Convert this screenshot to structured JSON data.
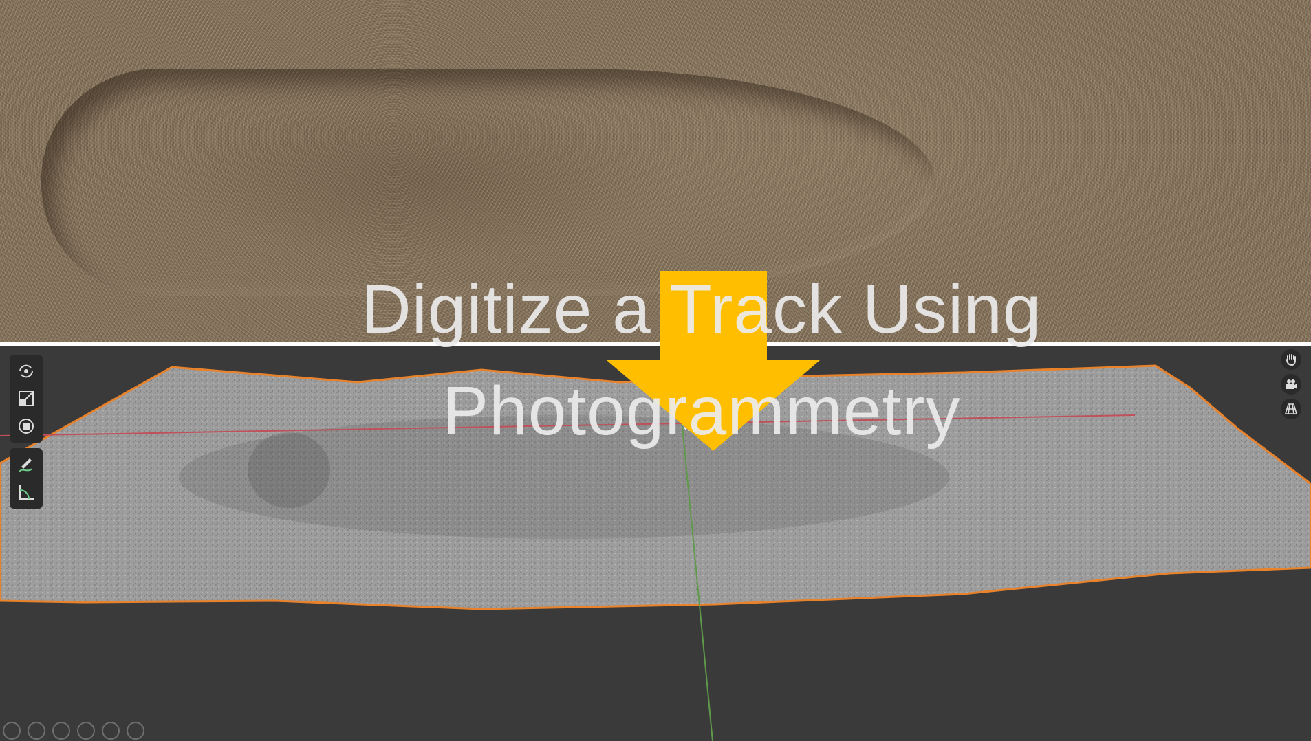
{
  "title": {
    "line1": "Digitize a Track Using",
    "line2": "Photogrammetry"
  },
  "colors": {
    "arrow": "#FFBF00",
    "mesh_outline": "#E8822B",
    "mesh_surface": "#9a9a9a",
    "viewport_bg": "#3a3a3a",
    "x_axis": "#c0505a",
    "y_axis": "#5f9a4a"
  },
  "viewport": {
    "left_tools": [
      {
        "icon": "orbit-icon"
      },
      {
        "icon": "scale-icon"
      },
      {
        "icon": "transform-icon"
      },
      {
        "icon": "annotate-icon"
      },
      {
        "icon": "measure-icon"
      }
    ],
    "right_nav": [
      {
        "icon": "hand-pan-icon"
      },
      {
        "icon": "camera-icon"
      },
      {
        "icon": "grid-perspective-icon"
      }
    ],
    "bottom_buttons": 6
  }
}
